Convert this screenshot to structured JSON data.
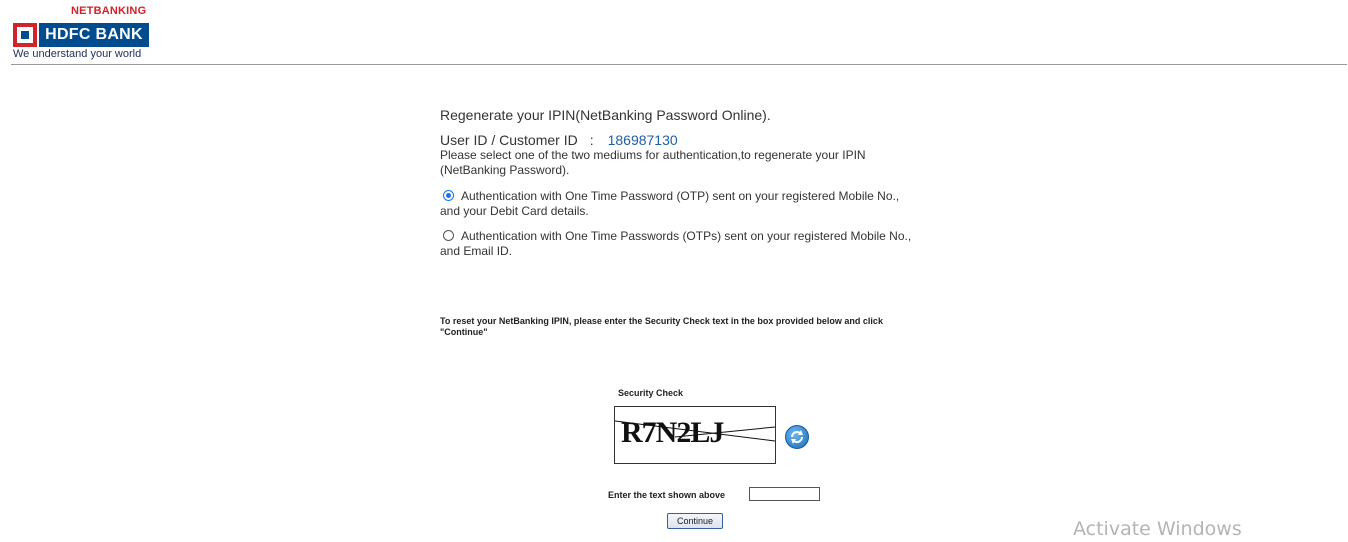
{
  "header": {
    "netbanking_label": "NETBANKING",
    "bank_name": "HDFC BANK",
    "tagline": "We understand your world",
    "brand_colors": {
      "red": "#d2232a",
      "blue": "#004c8f"
    }
  },
  "main": {
    "heading": "Regenerate your IPIN(NetBanking Password Online).",
    "userid_label": "User ID / Customer ID",
    "userid_separator": ":",
    "userid_value": "186987130",
    "instruction": "Please select one of the two mediums for authentication,to regenerate your IPIN (NetBanking Password).",
    "options": [
      {
        "label": "Authentication with One Time Password (OTP) sent on your registered Mobile No., and your Debit Card details.",
        "selected": true
      },
      {
        "label": "Authentication with One Time Passwords (OTPs) sent on your registered Mobile No., and Email ID.",
        "selected": false
      }
    ],
    "reset_note": "To reset your NetBanking IPIN, please enter the Security Check text in the box provided below and click \"Continue\""
  },
  "security": {
    "label": "Security Check",
    "captcha_text": "R7N2LJ",
    "refresh_icon": "refresh-icon",
    "enter_label": "Enter the text shown above",
    "input_value": "",
    "continue_label": "Continue"
  },
  "overlay": {
    "activate_windows": "Activate Windows"
  }
}
